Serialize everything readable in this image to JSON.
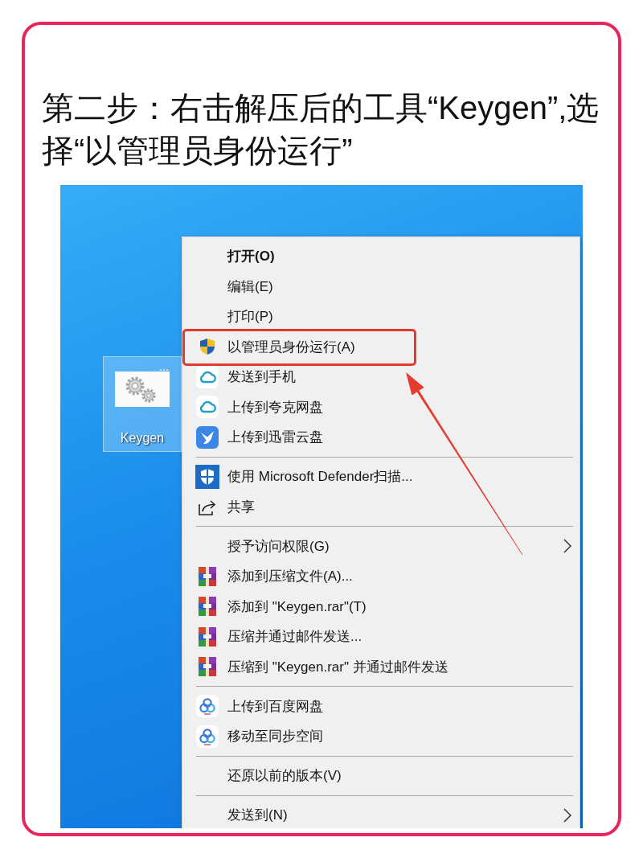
{
  "title": "第二步：右击解压后的工具“Keygen”,选择“以管理员身份运行”",
  "desktop_icon": {
    "label": "Keygen",
    "selected": true
  },
  "context_menu": {
    "groups": [
      {
        "items": [
          {
            "label": "打开(O)",
            "kind": "plain",
            "default": true,
            "submenu": false,
            "highlighted": false
          },
          {
            "label": "编辑(E)",
            "kind": "plain",
            "default": false,
            "submenu": false,
            "highlighted": false
          },
          {
            "label": "打印(P)",
            "kind": "plain",
            "default": false,
            "submenu": false,
            "highlighted": false
          },
          {
            "label": "以管理员身份运行(A)",
            "kind": "shield",
            "default": false,
            "submenu": false,
            "highlighted": true
          },
          {
            "label": "发送到手机",
            "kind": "cloud",
            "default": false,
            "submenu": false,
            "highlighted": false
          },
          {
            "label": "上传到夸克网盘",
            "kind": "cloud",
            "default": false,
            "submenu": false,
            "highlighted": false
          },
          {
            "label": "上传到迅雷云盘",
            "kind": "bird",
            "default": false,
            "submenu": false,
            "highlighted": false
          }
        ]
      },
      {
        "items": [
          {
            "label": "使用 Microsoft Defender扫描...",
            "kind": "shield-tile",
            "default": false,
            "submenu": false,
            "highlighted": false
          },
          {
            "label": "共享",
            "kind": "share",
            "default": false,
            "submenu": false,
            "highlighted": false
          }
        ]
      },
      {
        "items": [
          {
            "label": "授予访问权限(G)",
            "kind": "plain",
            "default": false,
            "submenu": true,
            "highlighted": false
          },
          {
            "label": "添加到压缩文件(A)...",
            "kind": "books",
            "default": false,
            "submenu": false,
            "highlighted": false
          },
          {
            "label": "添加到 \"Keygen.rar\"(T)",
            "kind": "books",
            "default": false,
            "submenu": false,
            "highlighted": false
          },
          {
            "label": "压缩并通过邮件发送...",
            "kind": "books",
            "default": false,
            "submenu": false,
            "highlighted": false
          },
          {
            "label": "压缩到 \"Keygen.rar\" 并通过邮件发送",
            "kind": "books",
            "default": false,
            "submenu": false,
            "highlighted": false
          }
        ]
      },
      {
        "items": [
          {
            "label": "上传到百度网盘",
            "kind": "rings",
            "default": false,
            "submenu": false,
            "highlighted": false
          },
          {
            "label": "移动至同步空间",
            "kind": "rings",
            "default": false,
            "submenu": false,
            "highlighted": false
          }
        ]
      },
      {
        "items": [
          {
            "label": "还原以前的版本(V)",
            "kind": "plain",
            "default": false,
            "submenu": false,
            "highlighted": false
          }
        ]
      },
      {
        "items": [
          {
            "label": "发送到(N)",
            "kind": "plain",
            "default": false,
            "submenu": true,
            "highlighted": false
          }
        ]
      }
    ]
  },
  "arrow": true
}
